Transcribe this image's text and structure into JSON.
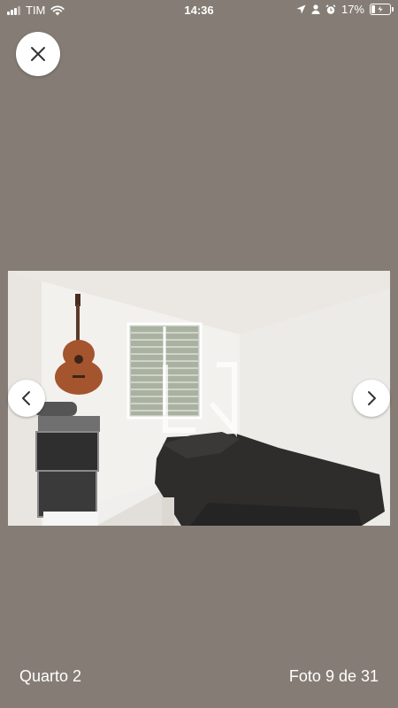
{
  "status_bar": {
    "carrier": "TIM",
    "time": "14:36",
    "battery_percent": "17%",
    "icons": [
      "signal-icon",
      "wifi-icon",
      "location-icon",
      "person-icon",
      "alarm-icon",
      "battery-charging-icon"
    ]
  },
  "viewer": {
    "close_icon": "close-icon",
    "prev_icon": "chevron-left-icon",
    "next_icon": "chevron-right-icon",
    "room_label": "Quarto 2",
    "photo_counter": "Foto 9 de 31",
    "current_photo": 9,
    "total_photos": 31
  },
  "colors": {
    "background": "#857d75",
    "button_bg": "#ffffff",
    "text": "#ffffff"
  }
}
